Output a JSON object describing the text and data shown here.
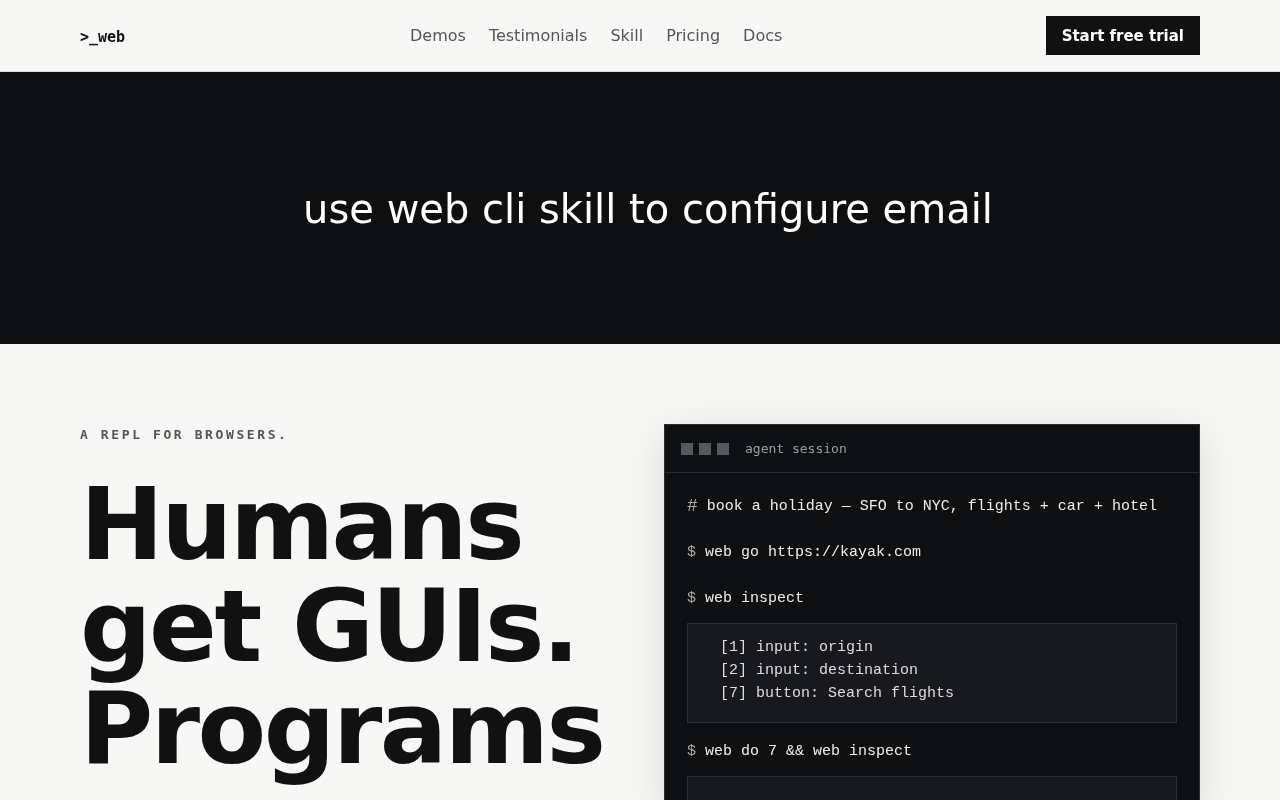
{
  "nav": {
    "logo": ">_web",
    "links": [
      "Demos",
      "Testimonials",
      "Skill",
      "Pricing",
      "Docs"
    ],
    "cta": "Start free trial"
  },
  "banner": {
    "text": "use web cli skill to configure email"
  },
  "hero": {
    "eyebrow": "A REPL FOR BROWSERS.",
    "headline": [
      "Humans",
      "get GUIs.",
      "Programs"
    ]
  },
  "terminal": {
    "title": "agent session",
    "blocks": [
      {
        "kind": "comment",
        "prompt": "#",
        "text": "book a holiday — SFO to NYC, flights + car + hotel"
      },
      {
        "kind": "command",
        "prompt": "$",
        "text": "web go https://kayak.com"
      },
      {
        "kind": "command",
        "prompt": "$",
        "text": "web inspect"
      },
      {
        "kind": "output",
        "lines": [
          "[1] input: origin",
          "[2] input: destination",
          "[7] button: Search flights"
        ]
      },
      {
        "kind": "command",
        "prompt": "$",
        "text": "web do 7 && web inspect"
      },
      {
        "kind": "output"
      }
    ]
  }
}
